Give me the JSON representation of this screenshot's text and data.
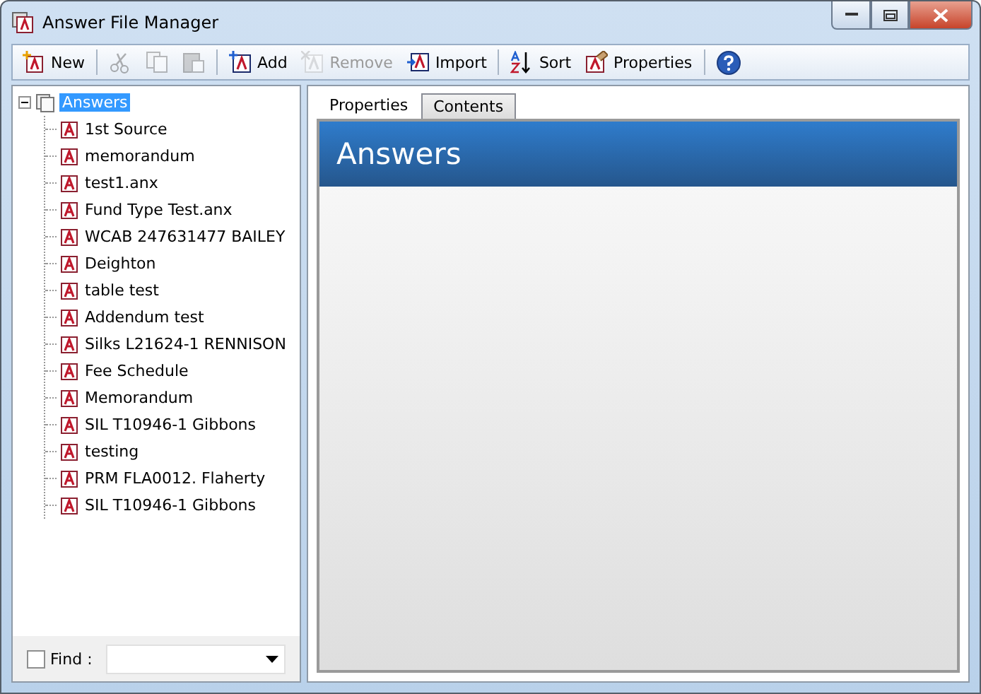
{
  "window": {
    "title": "Answer File Manager"
  },
  "toolbar": [
    {
      "kind": "new",
      "label": "New",
      "disabled": false
    },
    {
      "kind": "separator"
    },
    {
      "kind": "cut",
      "disabled": true
    },
    {
      "kind": "copy",
      "disabled": true
    },
    {
      "kind": "paste",
      "disabled": true
    },
    {
      "kind": "separator"
    },
    {
      "kind": "add",
      "label": "Add",
      "disabled": false
    },
    {
      "kind": "remove",
      "label": "Remove",
      "disabled": true
    },
    {
      "kind": "import",
      "label": "Import",
      "disabled": false
    },
    {
      "kind": "separator"
    },
    {
      "kind": "sort",
      "label": "Sort",
      "disabled": false
    },
    {
      "kind": "properties",
      "label": "Properties",
      "disabled": false
    },
    {
      "kind": "separator"
    },
    {
      "kind": "help",
      "disabled": false
    }
  ],
  "tree": {
    "label": "Answers",
    "expanded": true,
    "selected": true,
    "children": [
      {
        "label": "1st Source",
        "selected": false
      },
      {
        "label": "memorandum",
        "selected": false
      },
      {
        "label": "test1.anx",
        "selected": false
      },
      {
        "label": "Fund Type Test.anx",
        "selected": false
      },
      {
        "label": "WCAB 247631477 BAILEY",
        "selected": false
      },
      {
        "label": "Deighton",
        "selected": false
      },
      {
        "label": "table test",
        "selected": false
      },
      {
        "label": "Addendum test",
        "selected": false
      },
      {
        "label": "Silks L21624-1 RENNISON",
        "selected": false
      },
      {
        "label": "Fee Schedule",
        "selected": false
      },
      {
        "label": "Memorandum",
        "selected": false
      },
      {
        "label": "SIL T10946-1 Gibbons",
        "selected": false
      },
      {
        "label": "testing",
        "selected": false
      },
      {
        "label": "PRM FLA0012. Flaherty",
        "selected": false
      },
      {
        "label": "SIL T10946-1 Gibbons",
        "selected": false
      }
    ]
  },
  "find": {
    "label": "Find :",
    "checked": false
  },
  "tabs": [
    {
      "label": "Properties",
      "selected": true
    },
    {
      "label": "Contents",
      "selected": false
    }
  ],
  "header": {
    "title": "Answers"
  }
}
